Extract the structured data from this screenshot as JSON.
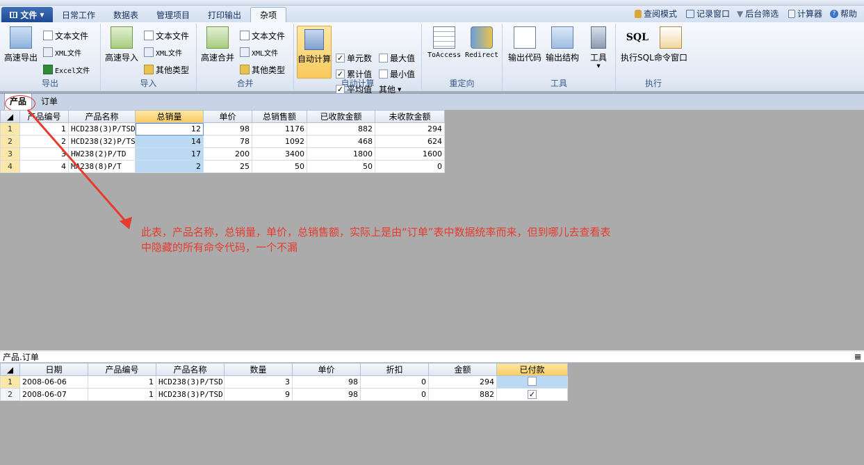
{
  "ribbon_tabs": {
    "file": "文件",
    "tabs": [
      "日常工作",
      "数据表",
      "管理项目",
      "打印输出",
      "杂项"
    ]
  },
  "quick_actions": {
    "view_mode": "查阅模式",
    "record_window": "记录窗口",
    "filter": "后台筛选",
    "calculator": "计算器",
    "help": "帮助"
  },
  "ribbon": {
    "export": {
      "big": "高速导出",
      "text": "文本文件",
      "xml": "XML文件",
      "excel": "Excel文件",
      "label": "导出"
    },
    "import": {
      "big": "高速导入",
      "text": "文本文件",
      "xml": "XML文件",
      "other": "其他类型",
      "label": "导入"
    },
    "merge": {
      "big": "高速合并",
      "text": "文本文件",
      "xml": "XML文件",
      "other": "其他类型",
      "label": "合并"
    },
    "autocalc": {
      "big": "自动计算",
      "cell_count": "单元数",
      "max": "最大值",
      "cumulative": "累计值",
      "min": "最小值",
      "average": "平均值",
      "other": "其他",
      "label": "自动计算"
    },
    "redirect": {
      "toaccess": "ToAccess",
      "redirect": "Redirect",
      "label": "重定向"
    },
    "tools": {
      "output_code": "输出代码",
      "output_structure": "输出结构",
      "tools": "工具",
      "label": "工具"
    },
    "execute": {
      "sql": "执行SQL",
      "cmd": "命令窗口",
      "label": "执行"
    }
  },
  "sheet_tabs": [
    "产品",
    "订单"
  ],
  "products": {
    "headers": [
      "产品编号",
      "产品名称",
      "总销量",
      "单价",
      "总销售额",
      "已收款金额",
      "未收款金额"
    ],
    "rows": [
      {
        "rn": "1",
        "id": "1",
        "name": "HCD238(3)P/TSD",
        "qty": "12",
        "price": "98",
        "sales": "1176",
        "received": "882",
        "unreceived": "294"
      },
      {
        "rn": "2",
        "id": "2",
        "name": "HCD238(32)P/TS",
        "qty": "14",
        "price": "78",
        "sales": "1092",
        "received": "468",
        "unreceived": "624"
      },
      {
        "rn": "3",
        "id": "3",
        "name": "HW238(2)P/TD",
        "qty": "17",
        "price": "200",
        "sales": "3400",
        "received": "1800",
        "unreceived": "1600"
      },
      {
        "rn": "4",
        "id": "4",
        "name": "MA238(8)P/T",
        "qty": "2",
        "price": "25",
        "sales": "50",
        "received": "50",
        "unreceived": "0"
      }
    ]
  },
  "annotation": "此表，产品名称，总销量，单价，总销售额，实际上是由“订单”表中数据统率而来，但到哪儿去查看表中隐藏的所有命令代码，一个不漏",
  "subpanel": {
    "title": "产品.订单",
    "pin": "𝌆",
    "headers": [
      "日期",
      "产品编号",
      "产品名称",
      "数量",
      "单价",
      "折扣",
      "金额",
      "已付款"
    ],
    "rows": [
      {
        "rn": "1",
        "date": "2008-06-06",
        "id": "1",
        "name": "HCD238(3)P/TSD",
        "qty": "3",
        "price": "98",
        "discount": "0",
        "amount": "294",
        "paid": false
      },
      {
        "rn": "2",
        "date": "2008-06-07",
        "id": "1",
        "name": "HCD238(3)P/TSD",
        "qty": "9",
        "price": "98",
        "discount": "0",
        "amount": "882",
        "paid": true
      }
    ]
  },
  "colors": {
    "annotation": "#e63b2e",
    "highlight_header": "#f8cb62",
    "selected_cell": "#bcd9f4"
  }
}
